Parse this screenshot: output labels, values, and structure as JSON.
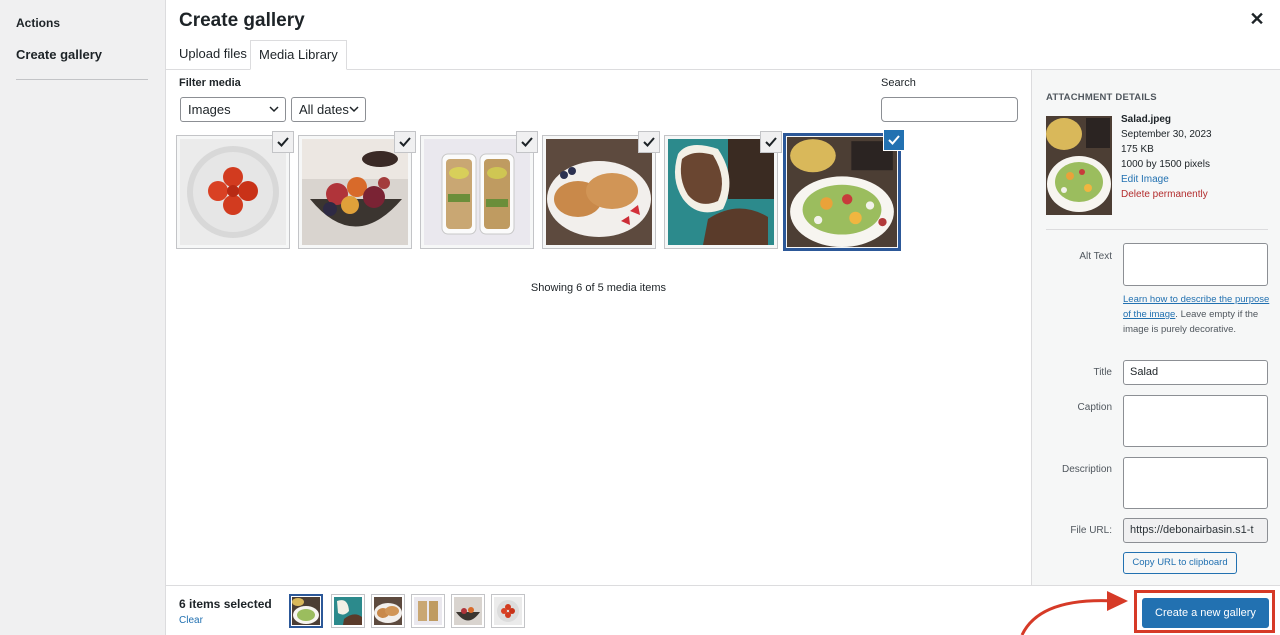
{
  "menu": {
    "heading": "Actions",
    "item": "Create gallery"
  },
  "modal": {
    "title": "Create gallery",
    "close_icon": "close-icon"
  },
  "tabs": [
    {
      "label": "Upload files"
    },
    {
      "label": "Media Library"
    }
  ],
  "filters": {
    "label": "Filter media",
    "type_selected": "Images",
    "date_selected": "All dates",
    "search_label": "Search",
    "search_value": ""
  },
  "attachments": [
    {
      "name": "tomatoes",
      "icon": "tomatoes-thumbnail",
      "selected": true
    },
    {
      "name": "fruit-bowl",
      "icon": "fruit-bowl-thumbnail",
      "selected": true
    },
    {
      "name": "meal-prep",
      "icon": "meal-prep-thumbnail",
      "selected": true
    },
    {
      "name": "pancakes",
      "icon": "pancakes-thumbnail",
      "selected": true
    },
    {
      "name": "coconut",
      "icon": "coconut-thumbnail",
      "selected": true
    },
    {
      "name": "salad",
      "icon": "salad-thumbnail",
      "selected": true,
      "active": true
    }
  ],
  "showing_text": "Showing 6 of 5 media items",
  "details": {
    "heading": "ATTACHMENT DETAILS",
    "filename": "Salad.jpeg",
    "date": "September 30, 2023",
    "size": "175 KB",
    "dimensions": "1000 by 1500 pixels",
    "edit_link": "Edit Image",
    "delete_link": "Delete permanently"
  },
  "settings": {
    "alt_label": "Alt Text",
    "alt_value": "",
    "alt_help_link": "Learn how to describe the purpose of the image",
    "alt_help_text": ". Leave empty if the image is purely decorative.",
    "title_label": "Title",
    "title_value": "Salad",
    "caption_label": "Caption",
    "caption_value": "",
    "description_label": "Description",
    "description_value": "",
    "url_label": "File URL:",
    "url_value": "https://debonairbasin.s1-t",
    "copy_button": "Copy URL to clipboard"
  },
  "toolbar": {
    "selection_count": "6 items selected",
    "clear_link": "Clear",
    "primary_button": "Create a new gallery"
  },
  "colors": {
    "accent": "#2271b1",
    "active_border": "#2c5898",
    "annotation": "#d63a27",
    "delete": "#b32d2e"
  }
}
